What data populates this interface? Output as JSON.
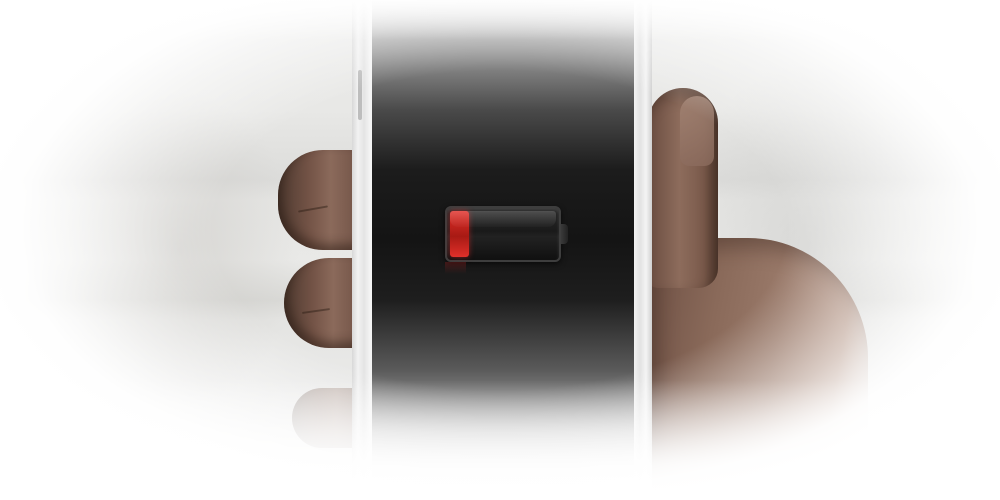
{
  "scene": {
    "subject": "phone-low-battery",
    "icon": "battery-low-icon",
    "battery": {
      "charge_level": 0.18,
      "level_color": "#e0302a",
      "level_color_dark": "#a81a14"
    },
    "colors": {
      "screen": "#141414",
      "phone_frame": "#f2f2f2",
      "background": "#ffffff"
    }
  }
}
